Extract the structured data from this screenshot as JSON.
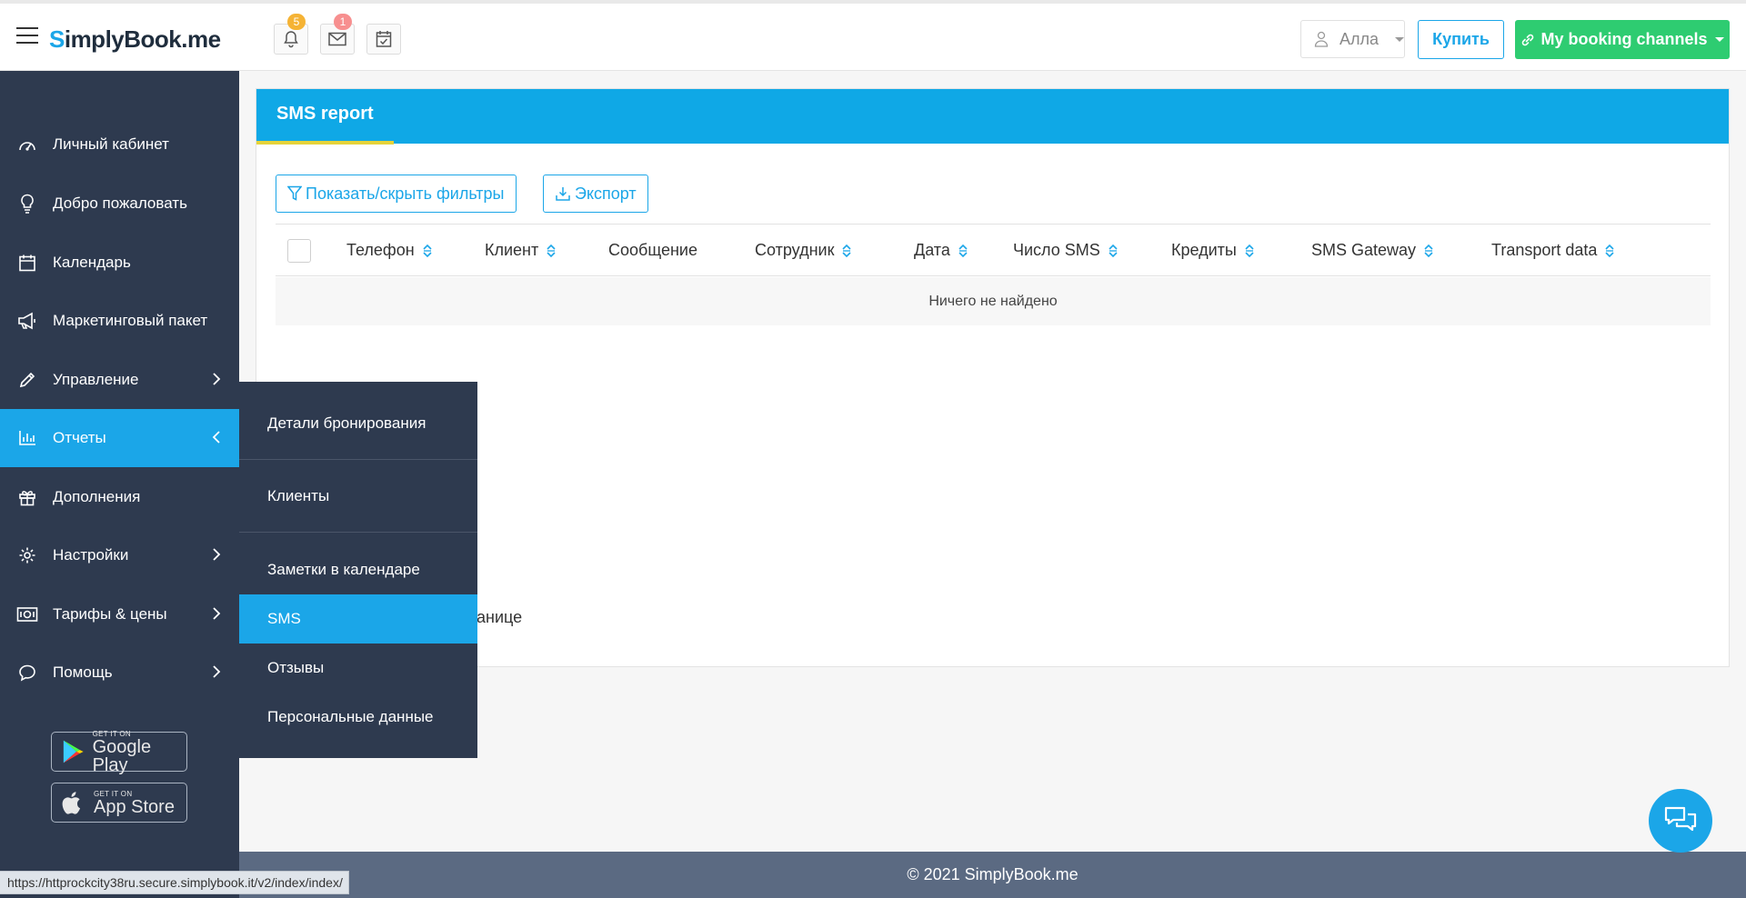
{
  "header": {
    "logo": {
      "s": "S",
      "imply": "implyBook",
      "me": ".me"
    },
    "notifications_count": "5",
    "messages_count": "1",
    "user_name": "Алла",
    "buy_label": "Купить",
    "channels_label": "My booking channels"
  },
  "sidebar": {
    "items": [
      {
        "label": "Личный кабинет",
        "icon": "dashboard-icon"
      },
      {
        "label": "Добро пожаловать",
        "icon": "lightbulb-icon"
      },
      {
        "label": "Календарь",
        "icon": "calendar-icon"
      },
      {
        "label": "Маркетинговый пакет",
        "icon": "megaphone-icon"
      },
      {
        "label": "Управление",
        "icon": "pencil-icon"
      },
      {
        "label": "Отчеты",
        "icon": "bar-chart-icon"
      },
      {
        "label": "Дополнения",
        "icon": "gift-icon"
      },
      {
        "label": "Настройки",
        "icon": "gear-icon"
      },
      {
        "label": "Тарифы & цены",
        "icon": "money-icon"
      },
      {
        "label": "Помощь",
        "icon": "chat-bubble-icon"
      }
    ],
    "active_index": 5,
    "google_play": {
      "small": "GET IT ON",
      "big": "Google Play"
    },
    "app_store": {
      "small": "GET IT ON",
      "big": "App Store"
    }
  },
  "submenu": {
    "items": [
      {
        "label": "Детали бронирования"
      },
      {
        "label": "Клиенты"
      },
      {
        "label": "Заметки в календаре"
      },
      {
        "label": "SMS"
      },
      {
        "label": "Отзывы"
      },
      {
        "label": "Персональные данные"
      }
    ],
    "active_index": 3
  },
  "report": {
    "title": "SMS report",
    "filter_button": "Показать/скрыть фильтры",
    "export_button": "Экспорт",
    "columns": [
      {
        "label": "Телефон",
        "sortable": true
      },
      {
        "label": "Клиент",
        "sortable": true
      },
      {
        "label": "Сообщение",
        "sortable": false
      },
      {
        "label": "Сотрудник",
        "sortable": true
      },
      {
        "label": "Дата",
        "sortable": true
      },
      {
        "label": "Число SMS",
        "sortable": true
      },
      {
        "label": "Кредиты",
        "sortable": true
      },
      {
        "label": "SMS Gateway",
        "sortable": true
      },
      {
        "label": "Transport data",
        "sortable": true
      }
    ],
    "empty_text": "Ничего не найдено",
    "pagination_text_visible": "анице"
  },
  "footer": {
    "copyright": "© 2021 SimplyBook.me"
  },
  "status_url": "https://httprockcity38ru.secure.simplybook.it/v2/index/index/",
  "colors": {
    "accent": "#1ba6e8",
    "sidebar": "#2e3a4f",
    "success": "#2ecc71",
    "underline": "#e6d33a",
    "footer": "#5b6a82"
  }
}
